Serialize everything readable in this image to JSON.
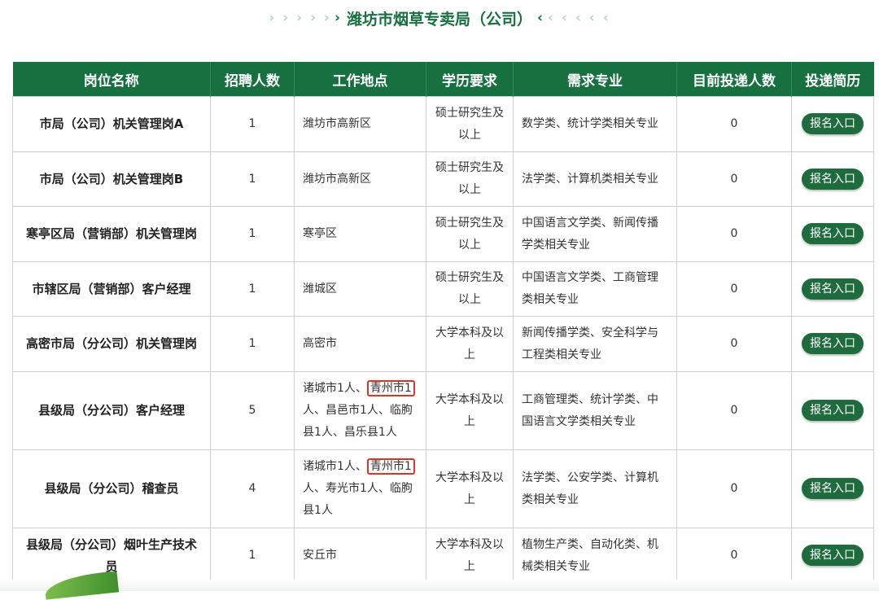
{
  "header": {
    "left_arrows": "› › › › ›",
    "left_arrow_strong": "›",
    "title": "潍坊市烟草专卖局（公司）",
    "right_arrow_strong": "‹",
    "right_arrows": "‹ ‹ ‹ ‹ ‹"
  },
  "table": {
    "columns": [
      "岗位名称",
      "招聘人数",
      "工作地点",
      "学历要求",
      "需求专业",
      "目前投递人数",
      "投递简历"
    ],
    "button_label": "报名入口",
    "rows": [
      {
        "position": "市局（公司）机关管理岗A",
        "count": "1",
        "location": "潍坊市高新区",
        "education": "硕士研究生及以上",
        "major": "数学类、统计学类相关专业",
        "applicants": "0"
      },
      {
        "position": "市局（公司）机关管理岗B",
        "count": "1",
        "location": "潍坊市高新区",
        "education": "硕士研究生及以上",
        "major": "法学类、计算机类相关专业",
        "applicants": "0"
      },
      {
        "position": "寒亭区局（营销部）机关管理岗",
        "count": "1",
        "location": "寒亭区",
        "education": "硕士研究生及以上",
        "major": "中国语言文学类、新闻传播学类相关专业",
        "applicants": "0"
      },
      {
        "position": "市辖区局（营销部）客户经理",
        "count": "1",
        "location": "潍城区",
        "education": "硕士研究生及以上",
        "major": "中国语言文学类、工商管理类相关专业",
        "applicants": "0"
      },
      {
        "position": "高密市局（分公司）机关管理岗",
        "count": "1",
        "location": "高密市",
        "education": "大学本科及以上",
        "major": "新闻传播学类、安全科学与工程类相关专业",
        "applicants": "0"
      },
      {
        "position": "县级局（分公司）客户经理",
        "count": "5",
        "location_pre": "诸城市1人、",
        "location_hl": "青州市1",
        "location_post": "人、昌邑市1人、临朐县1人、昌乐县1人",
        "education": "大学本科及以上",
        "major": "工商管理类、统计学类、中国语言文学类相关专业",
        "applicants": "0"
      },
      {
        "position": "县级局（分公司）稽查员",
        "count": "4",
        "location_pre": "诸城市1人、",
        "location_hl": "青州市1",
        "location_post": "人、寿光市1人、临朐县1人",
        "education": "大学本科及以上",
        "major": "法学类、公安学类、计算机类相关专业",
        "applicants": "0"
      },
      {
        "position": "县级局（分公司）烟叶生产技术员",
        "count": "1",
        "location": "安丘市",
        "education": "大学本科及以上",
        "major": "植物生产类、自动化类、机械类相关专业",
        "applicants": "0"
      }
    ]
  },
  "colors": {
    "accent": "#16703f",
    "button": "#1e6b3e",
    "highlight": "#d9362b"
  }
}
